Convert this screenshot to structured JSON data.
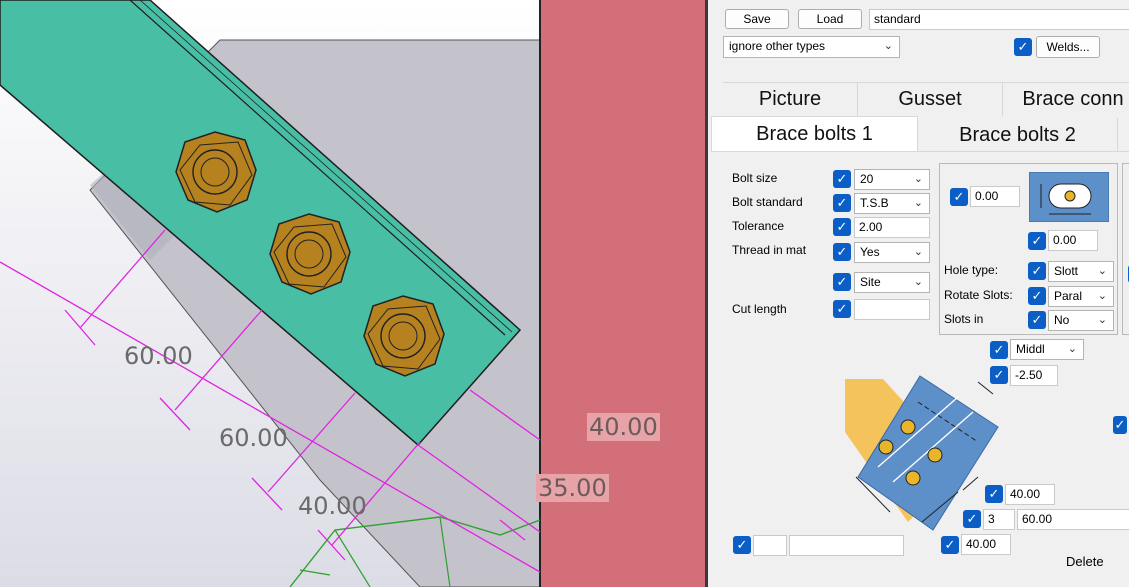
{
  "viewport": {
    "dimensions": [
      "60.00",
      "60.00",
      "40.00",
      "40.00",
      "35.00"
    ]
  },
  "toolbar": {
    "save_label": "Save",
    "load_label": "Load",
    "preset_value": "standard",
    "filter_value": "ignore other types",
    "welds_label": "Welds..."
  },
  "tabs": {
    "row1": [
      "Picture",
      "Gusset",
      "Brace conn"
    ],
    "row2": [
      "Brace bolts 1",
      "Brace bolts 2"
    ]
  },
  "bolts": {
    "bolt_size_label": "Bolt size",
    "bolt_size_value": "20",
    "bolt_standard_label": "Bolt standard",
    "bolt_standard_value": "T.S.B",
    "tolerance_label": "Tolerance",
    "tolerance_value": "2.00",
    "thread_label": "Thread in mat",
    "thread_value": "Yes",
    "site_value": "Site",
    "cut_length_label": "Cut length",
    "cut_length_value": "",
    "offset_top": "0.00",
    "offset_bottom": "0.00",
    "hole_type_label": "Hole type:",
    "hole_type_value": "Slott",
    "rotate_slots_label": "Rotate Slots:",
    "rotate_slots_value": "Paral",
    "slots_in_label": "Slots in",
    "slots_in_value": "No",
    "position_value": "Middl",
    "offset_value": "-2.50",
    "edge_dist_1": "40.00",
    "bolt_count": "3",
    "bolt_spacing": "60.00",
    "edge_dist_2": "40.00",
    "delete_label": "Delete"
  },
  "colors": {
    "beam": "#48bfa5",
    "gusset": "#c4c3cc",
    "column": "#d36f78",
    "dimension": "#e024e0",
    "bolt": "#b6821f",
    "checkbox": "#0a5ec6"
  }
}
